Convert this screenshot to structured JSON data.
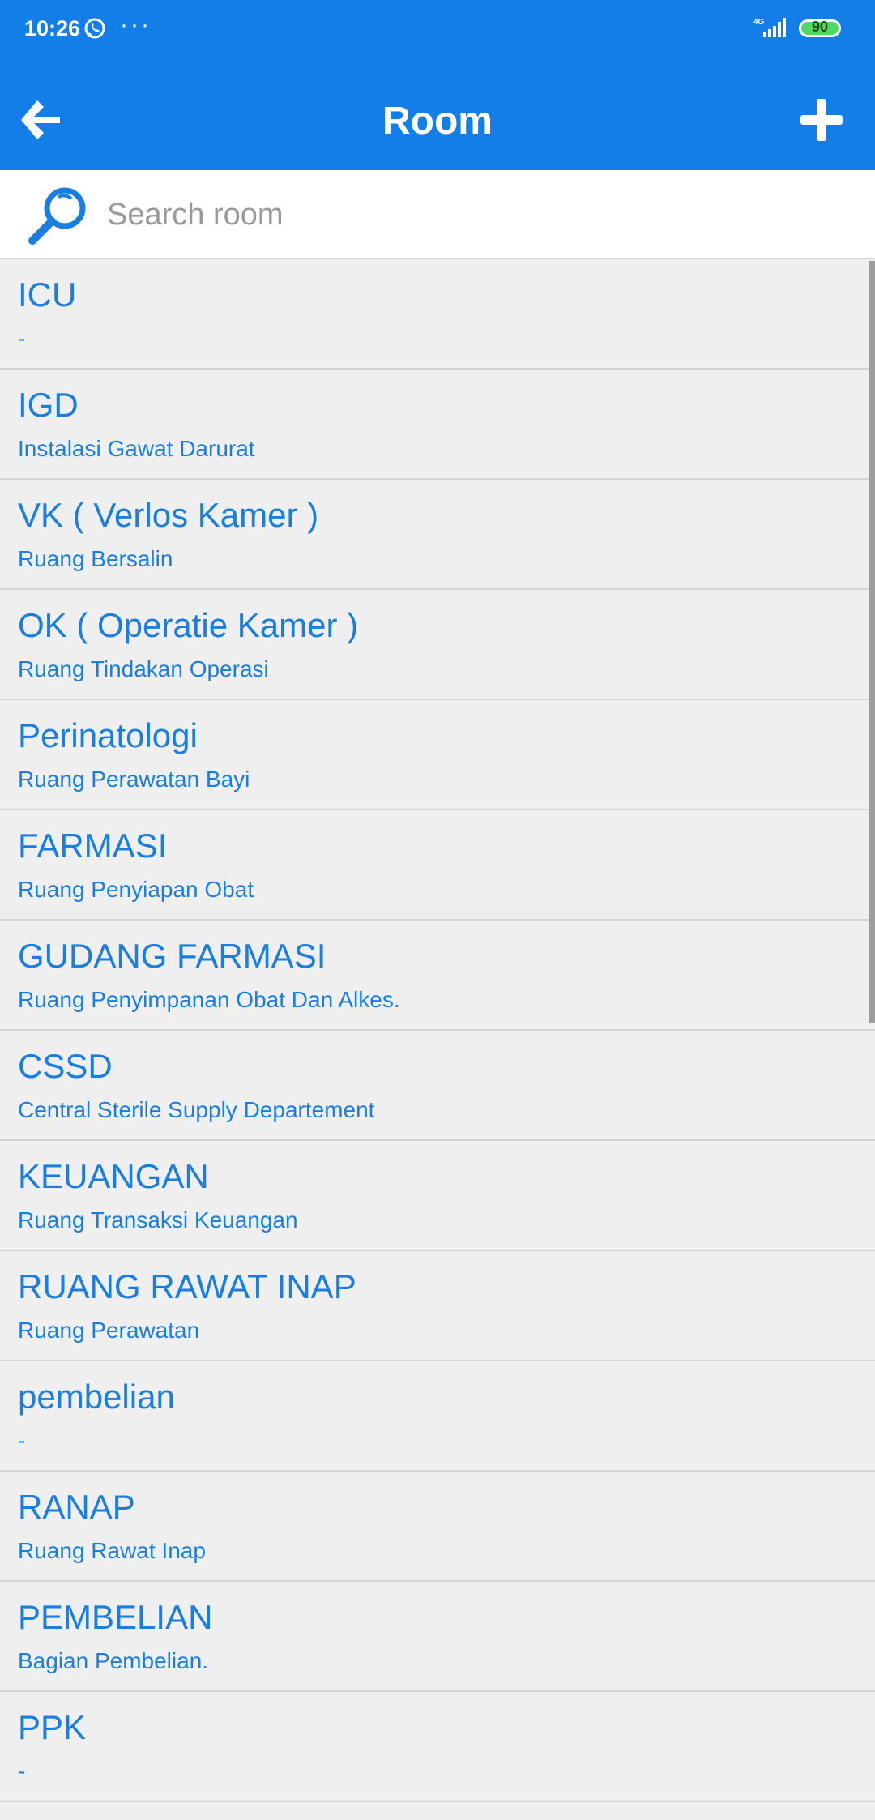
{
  "status_bar": {
    "time": "10:26",
    "dots": "···",
    "network": "4G",
    "battery": "90"
  },
  "header": {
    "title": "Room",
    "back_icon": "arrow-left-icon",
    "add_icon": "plus-icon"
  },
  "search": {
    "placeholder": "Search room",
    "icon": "magnifier-icon"
  },
  "rooms": [
    {
      "name": "ICU",
      "description": "-"
    },
    {
      "name": "IGD",
      "description": "Instalasi Gawat Darurat"
    },
    {
      "name": "VK ( Verlos Kamer )",
      "description": "Ruang Bersalin"
    },
    {
      "name": "OK ( Operatie Kamer )",
      "description": "Ruang Tindakan Operasi"
    },
    {
      "name": "Perinatologi",
      "description": "Ruang Perawatan Bayi"
    },
    {
      "name": "FARMASI",
      "description": "Ruang Penyiapan Obat"
    },
    {
      "name": "GUDANG FARMASI",
      "description": "Ruang Penyimpanan Obat Dan Alkes."
    },
    {
      "name": "CSSD",
      "description": "Central Sterile Supply Departement"
    },
    {
      "name": "KEUANGAN",
      "description": "Ruang Transaksi Keuangan"
    },
    {
      "name": "RUANG RAWAT INAP",
      "description": "Ruang Perawatan"
    },
    {
      "name": "pembelian",
      "description": "-"
    },
    {
      "name": "RANAP",
      "description": "Ruang Rawat Inap"
    },
    {
      "name": "PEMBELIAN",
      "description": "Bagian Pembelian."
    },
    {
      "name": "PPK",
      "description": "-"
    }
  ],
  "colors": {
    "primary": "#137de8",
    "text_blue": "#1a7ee0",
    "list_bg": "#efefef"
  }
}
